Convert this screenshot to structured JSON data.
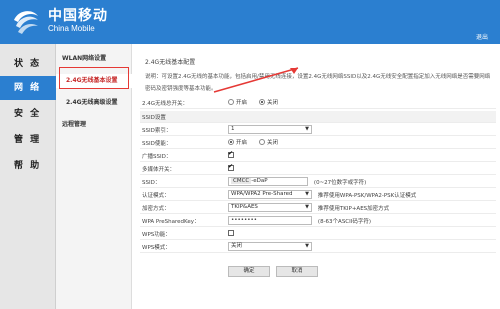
{
  "header": {
    "brand_cn": "中国移动",
    "brand_en": "China Mobile",
    "exit": "退出"
  },
  "nav": [
    {
      "label": "状 态"
    },
    {
      "label": "网 络"
    },
    {
      "label": "安 全"
    },
    {
      "label": "管 理"
    },
    {
      "label": "帮 助"
    }
  ],
  "subnav": {
    "wlan": "WLAN网络设置",
    "basic": "2.4G无线基本设置",
    "advanced": "2.4G无线高级设置",
    "remote": "远程管理"
  },
  "content": {
    "section_title": "2.4G无线基本配置",
    "description": "说明：可设置2.4G无线的基本功能，包括启用/禁用无线连接，设置2.4G无线网络SSID以及2.4G无线安全配置指定加入无线网络是否需要网络密码及密钥强度等基本功能。",
    "enable_label": "2.4G无线总开关：",
    "on": "开启",
    "off": "关闭",
    "ssid_section": "SSID设置",
    "ssid_index_label": "SSID索引：",
    "ssid_index_value": "1",
    "ssid_enable_label": "SSID使能：",
    "broadcast_label": "广播SSID：",
    "multicast_label": "多媒体开关：",
    "ssid_label": "SSID：",
    "ssid_prefix": "CMCC",
    "ssid_value": "-eDaP",
    "ssid_hint": "(0~27位数字或字符)",
    "auth_label": "认证模式：",
    "auth_value": "WPA/WPA2 Pre-Shared",
    "auth_hint": "推荐使用WPA-PSK/WPA2-PSK认证模式",
    "encrypt_label": "加密方式：",
    "encrypt_value": "TKIP&AES",
    "encrypt_hint": "推荐使用TKIP+AES加密方式",
    "psk_label": "WPA PreSharedKey：",
    "psk_value": "••••••••",
    "psk_hint": "(8-63个ASCII码字符)",
    "wps_label": "WPS功能：",
    "wps_mode_label": "WPS模式：",
    "wps_mode_value": "关闭",
    "confirm": "确定",
    "cancel": "取消"
  },
  "colors": {
    "brand": "#2b7fd0",
    "highlight": "#e53935"
  }
}
